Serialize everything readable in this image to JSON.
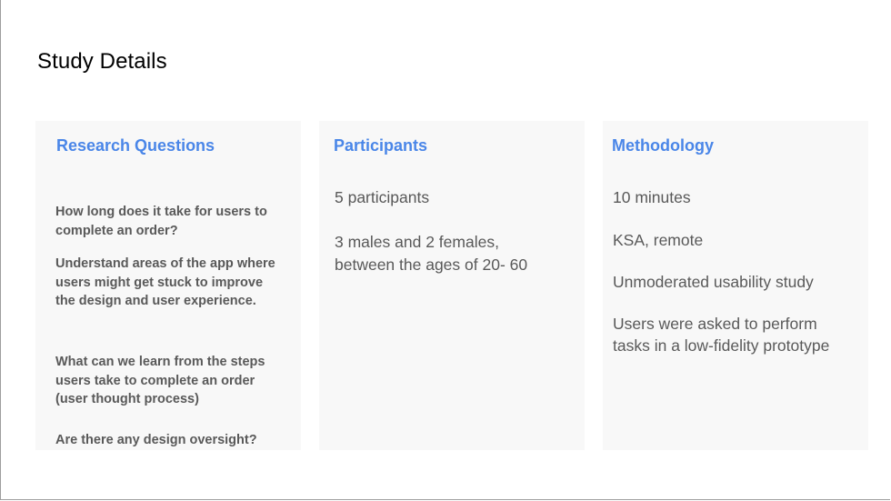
{
  "page_title": "Study Details",
  "colors": {
    "accent": "#4a86e8",
    "body_text": "#595959",
    "card_bg": "#f8f8f8"
  },
  "sections": {
    "research_questions": {
      "heading": "Research Questions",
      "items": [
        "How long does it take for users to complete an order?",
        "Understand areas of the app where users might get stuck to improve the design and user experience.",
        "What can we learn from the steps users take to complete an order (user thought process)",
        "Are there any design oversight?"
      ]
    },
    "participants": {
      "heading": "Participants",
      "items": [
        "5 participants",
        "3 males and 2 females, between the ages of 20- 60"
      ]
    },
    "methodology": {
      "heading": "Methodology",
      "items": [
        "10 minutes",
        "KSA, remote",
        "Unmoderated usability study",
        "Users were asked to perform tasks in a low-fidelity prototype"
      ]
    }
  }
}
